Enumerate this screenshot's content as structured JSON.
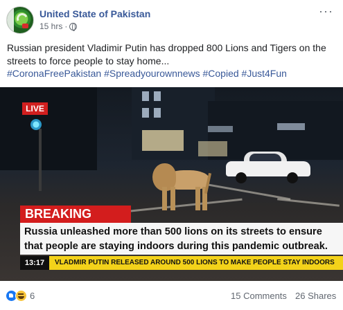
{
  "post": {
    "page_name": "United State of Pakistan",
    "time": "15 hrs",
    "separator": "·",
    "privacy_icon": "globe-icon",
    "more_label": "···",
    "text": "Russian president Vladimir Putin has dropped 800 Lions and Tigers on the streets to force people to stay home...",
    "hashtags": "#CoronaFreePakistan #Spreadyourownnews #Copied #Just4Fun"
  },
  "image": {
    "live_badge": "LIVE",
    "breaking_label": "BREAKING NEWS",
    "headline": "Russia unleashed more than 500 lions on its streets to ensure that people are staying indoors during this pandemic outbreak.",
    "ticker_time": "13:17",
    "ticker_text": "VLADMIR PUTIN RELEASED AROUND 500 LIONS TO MAKE PEOPLE STAY INDOORS"
  },
  "footer": {
    "reaction_icons": [
      "like-icon",
      "haha-icon"
    ],
    "reaction_count": "6",
    "comments": "15 Comments",
    "shares": "26 Shares"
  },
  "colors": {
    "link_blue": "#385898",
    "breaking_red": "#d31d1d",
    "ticker_yellow": "#f3d21a"
  }
}
